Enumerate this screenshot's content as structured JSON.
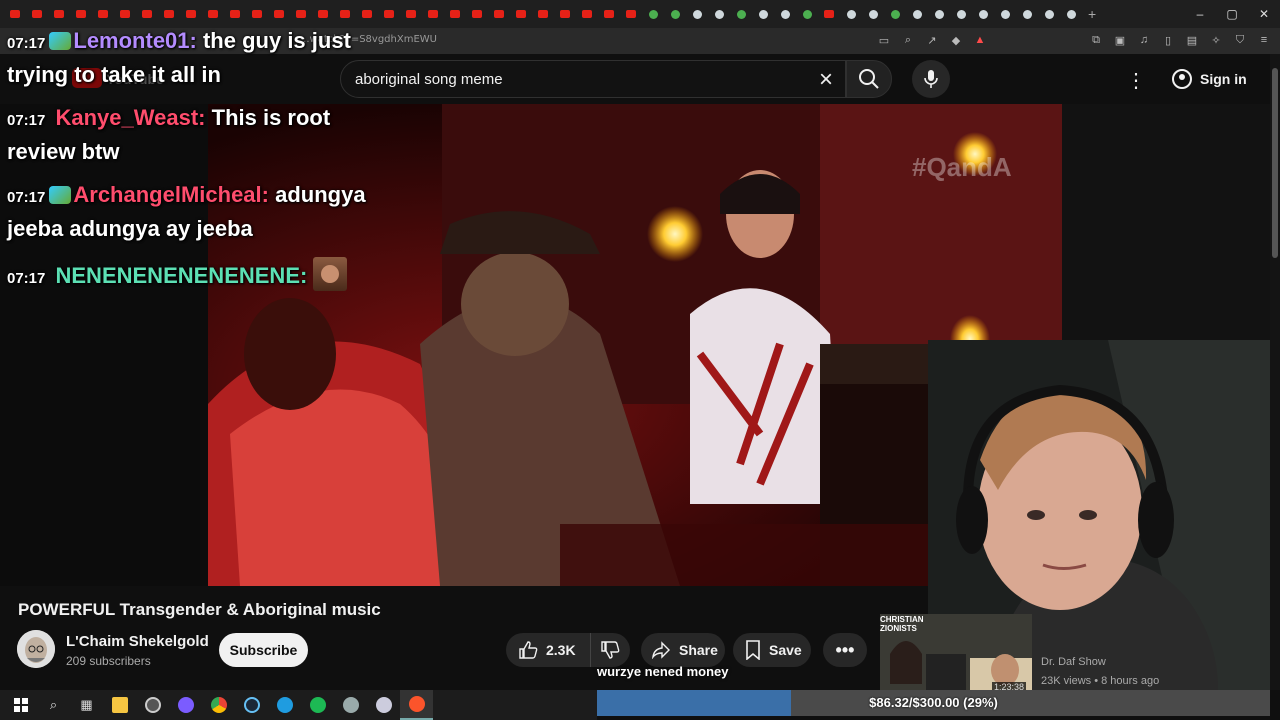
{
  "browser": {
    "url": "...watch?v=S8vgdhXmEWU",
    "new_tab_label": "+",
    "window_controls": [
      "–",
      "▢",
      "✕"
    ]
  },
  "youtube": {
    "logo_text": "YouTube",
    "search_query": "aboriginal song meme",
    "sign_in_label": "Sign in"
  },
  "video": {
    "watermark": "#QandA",
    "title": "POWERFUL Transgender & Aboriginal music",
    "channel_name": "L'Chaim Shekelgold",
    "subscribers": "209 subscribers",
    "subscribe_label": "Subscribe",
    "like_count": "2.3K",
    "share_label": "Share",
    "save_label": "Save",
    "more_label": "•••"
  },
  "chat": {
    "messages": [
      {
        "time": "07:17",
        "user": "Lemonte01:",
        "user_color": "#b48cff",
        "text": "the guy is just",
        "text2": "trying to take it all in"
      },
      {
        "time": "07:17",
        "user": "Kanye_Weast:",
        "user_color": "#ff4d6d",
        "text": "This is root",
        "text2": "review btw"
      },
      {
        "time": "07:17",
        "user": "ArchangelMicheal:",
        "user_color": "#ff4d6d",
        "text": "adungya",
        "text2": "jeeba adungya ay jeeba"
      },
      {
        "time": "07:17",
        "user": "NENENENENENENENE:",
        "user_color": "#5ce0b4",
        "text": "",
        "text2": ""
      }
    ]
  },
  "stream_overlay": {
    "ticker_text": "wurzye nened money",
    "goal_text": "$86.32/$300.00 (29%)",
    "goal_fraction": 0.2877
  },
  "recommendation": {
    "thumb_label": "CHRISTIAN ZIONISTS",
    "channel": "Dr. Daf Show",
    "meta": "23K views • 8 hours ago",
    "duration": "1:23:38"
  },
  "colors": {
    "accent": "#ff0000",
    "goal_fill": "#3a6fa8"
  }
}
